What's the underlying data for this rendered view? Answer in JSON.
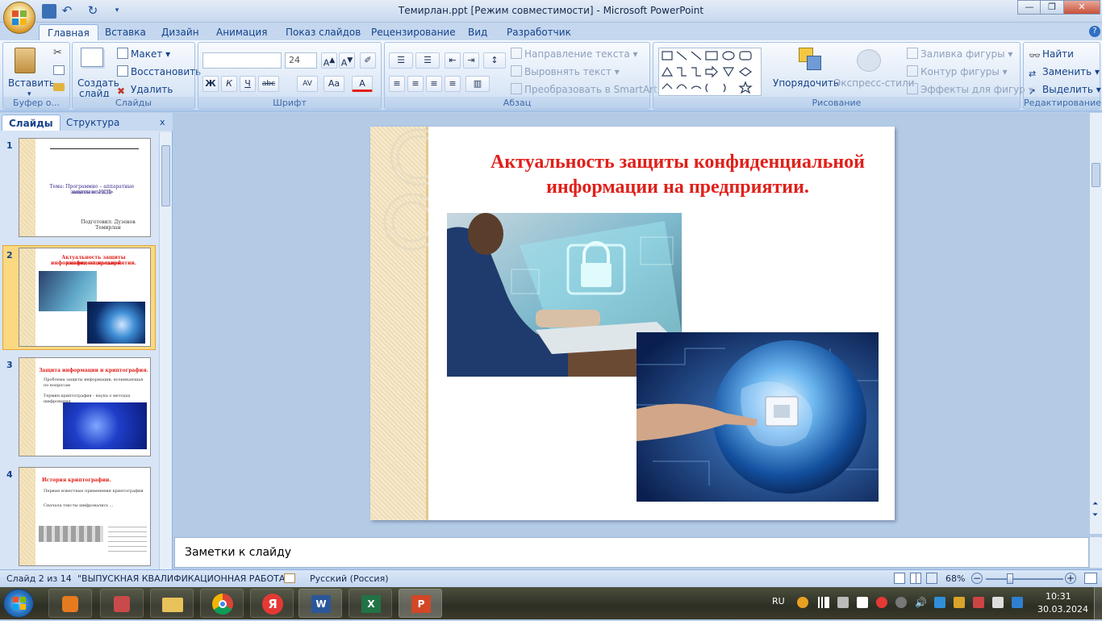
{
  "window": {
    "title": "Темирлан.ppt [Режим совместимости] - Microsoft PowerPoint",
    "minimize": "—",
    "maximize": "❐",
    "close": "✕"
  },
  "tabs": [
    "Главная",
    "Вставка",
    "Дизайн",
    "Анимация",
    "Показ слайдов",
    "Рецензирование",
    "Вид",
    "Разработчик"
  ],
  "ribbon": {
    "clipboard": {
      "label": "Буфер о...",
      "paste": "Вставить"
    },
    "slides": {
      "label": "Слайды",
      "new_slide_line1": "Создать",
      "new_slide_line2": "слайд",
      "layout": "Макет",
      "reset": "Восстановить",
      "delete": "Удалить"
    },
    "font": {
      "label": "Шрифт",
      "font_name": "",
      "font_size": "24",
      "bold": "Ж",
      "italic": "К",
      "underline": "Ч",
      "strike": "abc",
      "spacing": "AV",
      "case": "Aa",
      "color": "A"
    },
    "paragraph": {
      "label": "Абзац",
      "text_direction": "Направление текста",
      "align_text": "Выровнять текст",
      "smartart": "Преобразовать в SmartArt"
    },
    "drawing": {
      "label": "Рисование",
      "arrange": "Упорядочить",
      "quick_styles": "Экспресс-стили",
      "fill": "Заливка фигуры",
      "outline": "Контур фигуры",
      "effects": "Эффекты для фигур"
    },
    "editing": {
      "label": "Редактирование",
      "find": "Найти",
      "replace": "Заменить",
      "select": "Выделить"
    }
  },
  "panel": {
    "tab_slides": "Слайды",
    "tab_outline": "Структура",
    "close": "x",
    "thumbnails": [
      {
        "num": "1",
        "lines": [
          "Тема: Программно – аппаратные комплексы для",
          "защиты от НСД»",
          "Подготовил: Дузенов Темирлан"
        ]
      },
      {
        "num": "2",
        "lines": [
          "Актуальность защиты конфиденциальной",
          "информации на предприятии."
        ]
      },
      {
        "num": "3",
        "lines": [
          "Защита информации и криптография.",
          "Проблема защиты информации, возникающая по вопросам",
          "Термин криптография - наука о методах шифрования"
        ]
      },
      {
        "num": "4",
        "lines": [
          "История криптографии.",
          "Первые известные применения криптографии",
          "Сначала тексты шифровались ..."
        ]
      }
    ]
  },
  "slide": {
    "title_line1": "Актуальность защиты конфиденциальной",
    "title_line2": "информации на предприятии."
  },
  "notes": {
    "text": "Заметки к слайду"
  },
  "status": {
    "slide_counter": "Слайд 2 из 14",
    "theme": "\"ВЫПУСКНАЯ КВАЛИФИКАЦИОННАЯ РАБОТА\"",
    "language": "Русский (Россия)",
    "zoom": "68%"
  },
  "taskbar": {
    "lang": "RU",
    "time": "10:31",
    "date": "30.03.2024"
  },
  "colors": {
    "title_red": "#e0201a",
    "ribbon_bg": "#dbe7f6",
    "workspace_bg": "#b4cbe6",
    "selected_thumb": "#fbd980"
  }
}
